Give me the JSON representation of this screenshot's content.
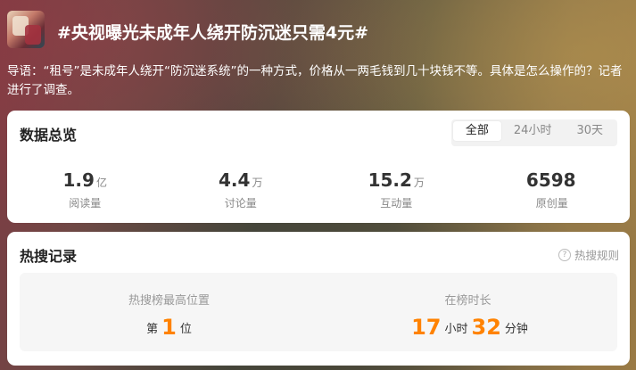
{
  "topic": {
    "title": "#央视曝光未成年人绕开防沉迷只需4元#",
    "intro": "导语：“租号”是未成年人绕开“防沉迷系统”的一种方式，价格从一两毛钱到几十块钱不等。具体是怎么操作的？记者进行了调查。"
  },
  "overview": {
    "title": "数据总览",
    "tabs": [
      "全部",
      "24小时",
      "30天"
    ],
    "active_tab": "全部",
    "stats": [
      {
        "value": "1.9",
        "unit": "亿",
        "label": "阅读量"
      },
      {
        "value": "4.4",
        "unit": "万",
        "label": "讨论量"
      },
      {
        "value": "15.2",
        "unit": "万",
        "label": "互动量"
      },
      {
        "value": "6598",
        "unit": "",
        "label": "原创量"
      }
    ]
  },
  "history": {
    "title": "热搜记录",
    "rules_label": "热搜规则",
    "rules_icon": "?",
    "rank_label": "热搜榜最高位置",
    "rank_prefix": "第",
    "rank_value": "1",
    "rank_suffix": "位",
    "duration_label": "在榜时长",
    "hours": "17",
    "hours_unit": "小时",
    "minutes": "32",
    "minutes_unit": "分钟"
  },
  "colors": {
    "accent": "#ff8200",
    "card_bg": "#ffffff",
    "muted_text": "#999999"
  }
}
